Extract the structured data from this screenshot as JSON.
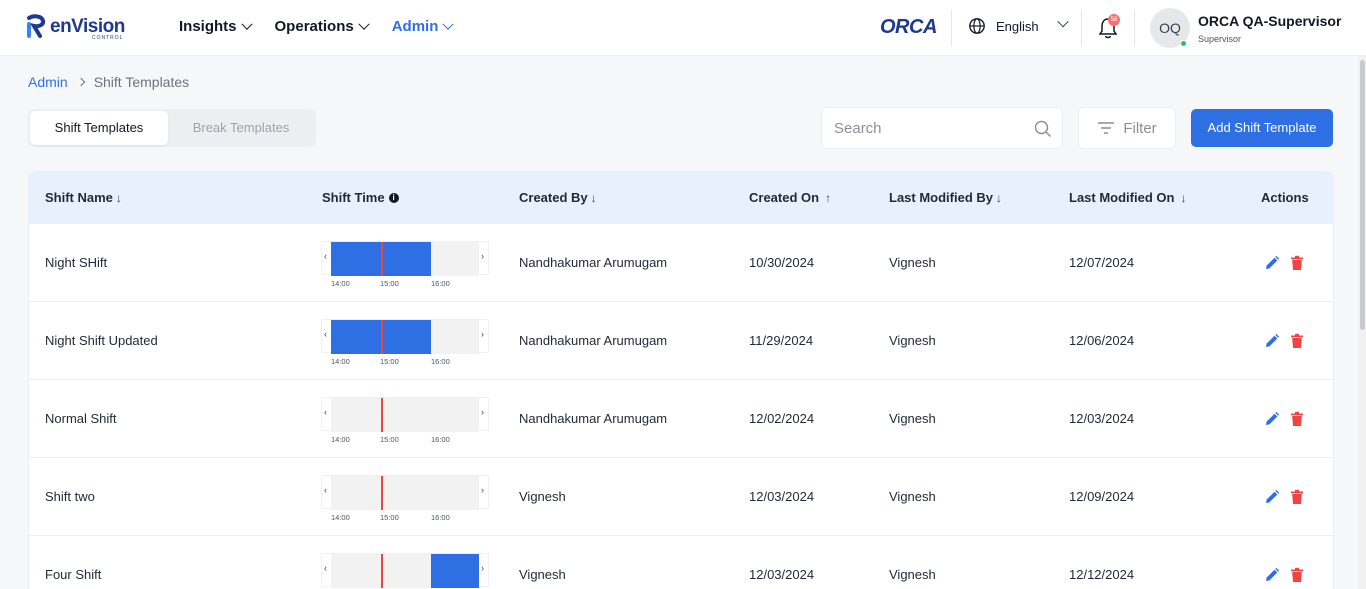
{
  "brand": {
    "name": "enVision",
    "sub": "CONTROL",
    "product": "ORCA"
  },
  "nav": [
    {
      "label": "Insights",
      "active": false
    },
    {
      "label": "Operations",
      "active": false
    },
    {
      "label": "Admin",
      "active": true
    }
  ],
  "header": {
    "language": "English",
    "notifications": "58",
    "user_initials": "OQ",
    "user_name": "ORCA QA-Supervisor",
    "user_role": "Supervisor"
  },
  "breadcrumb": {
    "root": "Admin",
    "current": "Shift Templates"
  },
  "tabs": {
    "active": "Shift Templates",
    "inactive": "Break Templates"
  },
  "search": {
    "placeholder": "Search"
  },
  "filter_label": "Filter",
  "add_button": "Add Shift Template",
  "columns": {
    "shift_name": "Shift Name",
    "shift_time": "Shift Time",
    "created_by": "Created By",
    "created_on": "Created On",
    "modified_by": "Last Modified By",
    "modified_on": "Last Modified On",
    "actions": "Actions"
  },
  "timeline_ticks": [
    "14:00",
    "15:00",
    "16:00"
  ],
  "rows": [
    {
      "name": "Night SHift",
      "created_by": "Nandhakumar Arumugam",
      "created_on": "10/30/2024",
      "modified_by": "Vignesh",
      "modified_on": "12/07/2024",
      "shift_fill": [
        0.0,
        0.676
      ]
    },
    {
      "name": "Night Shift Updated",
      "created_by": "Nandhakumar Arumugam",
      "created_on": "11/29/2024",
      "modified_by": "Vignesh",
      "modified_on": "12/06/2024",
      "shift_fill": [
        0.0,
        0.676
      ]
    },
    {
      "name": "Normal Shift",
      "created_by": "Nandhakumar Arumugam",
      "created_on": "12/02/2024",
      "modified_by": "Vignesh",
      "modified_on": "12/03/2024",
      "shift_fill": null
    },
    {
      "name": "Shift two",
      "created_by": "Vignesh",
      "created_on": "12/03/2024",
      "modified_by": "Vignesh",
      "modified_on": "12/09/2024",
      "shift_fill": null
    },
    {
      "name": "Four Shift",
      "created_by": "Vignesh",
      "created_on": "12/03/2024",
      "modified_by": "Vignesh",
      "modified_on": "12/12/2024",
      "shift_fill": [
        0.676,
        1.0
      ]
    }
  ],
  "colors": {
    "accent": "#2f6fe4",
    "delete": "#ef4444",
    "now_line": "#ef4444"
  }
}
